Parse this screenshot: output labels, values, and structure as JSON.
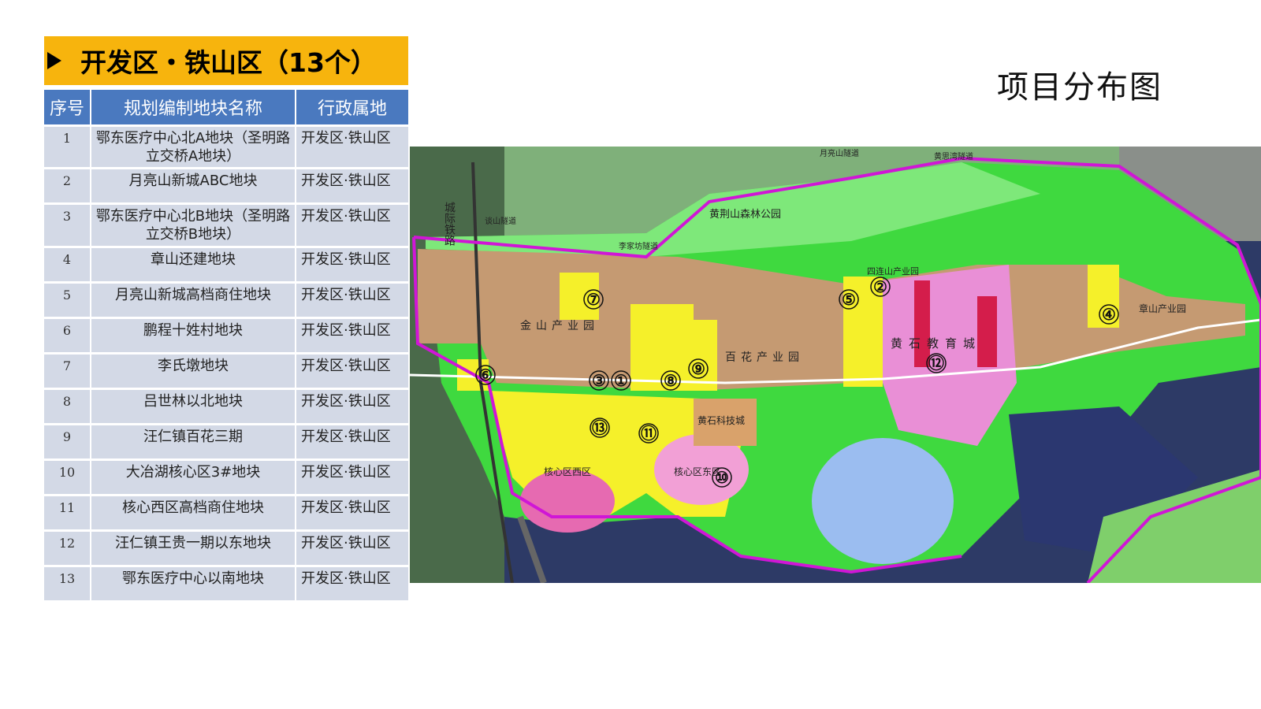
{
  "banner": {
    "title": "开发区・铁山区（13个）"
  },
  "table": {
    "headers": {
      "num": "序号",
      "name": "规划编制地块名称",
      "area": "行政属地"
    },
    "rows": [
      {
        "num": "1",
        "name": "鄂东医疗中心北A地块（圣明路立交桥A地块）",
        "area": "开发区·铁山区"
      },
      {
        "num": "2",
        "name": "月亮山新城ABC地块",
        "area": "开发区·铁山区"
      },
      {
        "num": "3",
        "name": "鄂东医疗中心北B地块（圣明路立交桥B地块）",
        "area": "开发区·铁山区"
      },
      {
        "num": "4",
        "name": "章山还建地块",
        "area": "开发区·铁山区"
      },
      {
        "num": "5",
        "name": "月亮山新城高档商住地块",
        "area": "开发区·铁山区"
      },
      {
        "num": "6",
        "name": "鹏程十姓村地块",
        "area": "开发区·铁山区"
      },
      {
        "num": "7",
        "name": "李氏墩地块",
        "area": "开发区·铁山区"
      },
      {
        "num": "8",
        "name": "吕世林以北地块",
        "area": "开发区·铁山区"
      },
      {
        "num": "9",
        "name": "汪仁镇百花三期",
        "area": "开发区·铁山区"
      },
      {
        "num": "10",
        "name": "大冶湖核心区3#地块",
        "area": "开发区·铁山区"
      },
      {
        "num": "11",
        "name": "核心西区高档商住地块",
        "area": "开发区·铁山区"
      },
      {
        "num": "12",
        "name": "汪仁镇王贵一期以东地块",
        "area": "开发区·铁山区"
      },
      {
        "num": "13",
        "name": "鄂东医疗中心以南地块",
        "area": "开发区·铁山区"
      }
    ]
  },
  "map": {
    "title": "项目分布图",
    "labels": {
      "railway": "城际铁路",
      "forest_park": "黄荆山森林公园",
      "jinshan": "金山产业园",
      "baihua": "百花产业园",
      "huangshi_edu": "黄石教育城",
      "sidianshan": "四连山产业园",
      "zhangshan": "章山产业园",
      "keji": "黄石科技城",
      "west": "核心区西区",
      "east": "核心区东区",
      "tunnel1": "月亮山隧道",
      "tunnel2": "黄思湾隧道",
      "tunnel3": "李家坊隧道",
      "tunnel4": "谈山隧道"
    },
    "markers": [
      "①",
      "②",
      "③",
      "④",
      "⑤",
      "⑥",
      "⑦",
      "⑧",
      "⑨",
      "⑩",
      "⑪",
      "⑫",
      "⑬"
    ]
  }
}
